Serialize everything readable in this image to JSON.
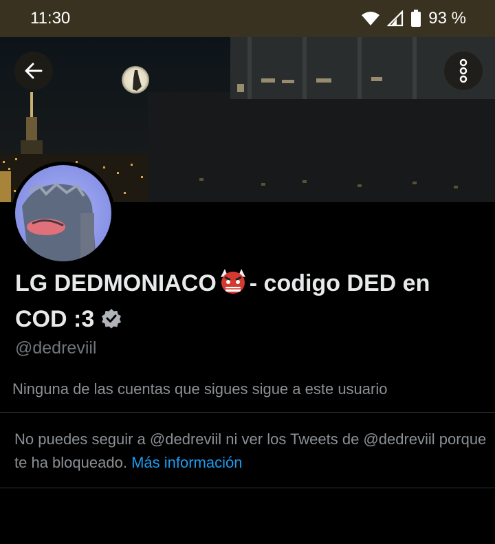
{
  "status_bar": {
    "time": "11:30",
    "battery_percent": "93 %",
    "icons": [
      "wifi-icon",
      "cell-signal-icon",
      "battery-icon"
    ]
  },
  "banner": {
    "back_icon": "arrow-left-icon",
    "more_icon": "vertical-dots-icon"
  },
  "profile": {
    "name_part1": "LG DEDMONIACO",
    "name_emoji": "👹",
    "name_part2": "- codigo DED en COD :3",
    "verified_icon": "verified-badge-icon",
    "handle": "@dedreviil",
    "follow_note": "Ninguna de las cuentas que sigues sigue a este usuario",
    "blocked_text": "No puedes seguir a @dedreviil ni ver los Tweets de @dedreviil porque te ha bloqueado.",
    "more_info_link": "Más información"
  },
  "colors": {
    "status_bar_bg": "#3a3220",
    "background": "#000000",
    "text_primary": "#e7e9ea",
    "text_secondary": "#71767b",
    "link": "#1d9bf0"
  }
}
